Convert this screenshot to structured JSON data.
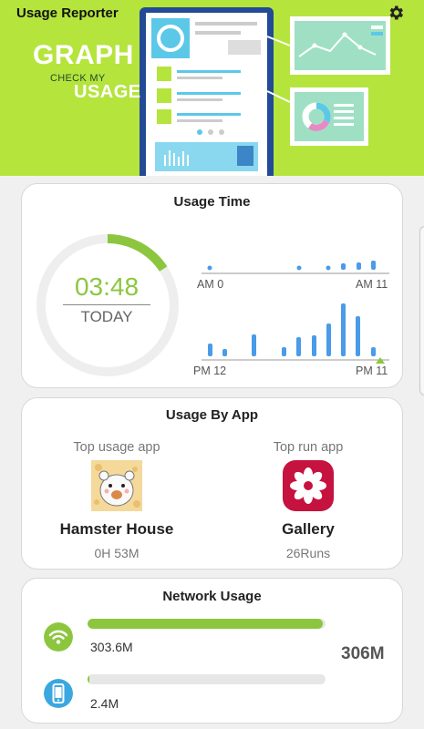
{
  "header": {
    "app_title": "Usage Reporter",
    "tagline_graph": "GRAPH",
    "tagline_check": "CHECK MY",
    "tagline_usage": "USAGE",
    "settings_icon": "gear-icon",
    "accent": "#b5e43d"
  },
  "usage_time": {
    "title": "Usage Time",
    "time": "03:48",
    "period": "TODAY",
    "dial_progress": 0.158,
    "am_start_label": "AM 0",
    "am_end_label": "AM 11",
    "pm_start_label": "PM 12",
    "pm_end_label": "PM 11"
  },
  "usage_by_app": {
    "title": "Usage By App",
    "top_usage": {
      "caption": "Top usage app",
      "name": "Hamster House",
      "value": "0H 53M",
      "icon": "hamster-icon"
    },
    "top_run": {
      "caption": "Top run app",
      "name": "Gallery",
      "value": "26Runs",
      "icon": "gallery-flower-icon"
    }
  },
  "network": {
    "title": "Network Usage",
    "total": "306M",
    "items": [
      {
        "icon": "wifi-icon",
        "value": "303.6M",
        "fraction": 0.99
      },
      {
        "icon": "mobile-phone-icon",
        "value": "2.4M",
        "fraction": 0.008
      }
    ]
  },
  "colors": {
    "accent_green": "#8cc63f",
    "bar_blue": "#4a9be8",
    "mobile_blue": "#3aa7e0"
  }
}
